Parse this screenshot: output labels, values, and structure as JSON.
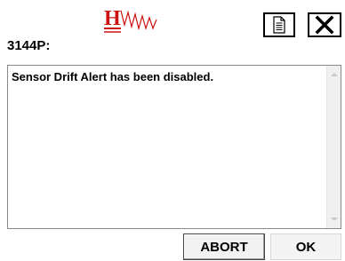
{
  "header": {
    "logo_icon": "hw-logo-icon",
    "logo_text": "H",
    "logo_color": "#cc1111",
    "doc_icon": "document-icon",
    "close_icon": "close-icon",
    "close_glyph": "✕",
    "doc_glyph": "🗎"
  },
  "device": {
    "label": "3144P:"
  },
  "message": {
    "text": "Sensor Drift Alert has been disabled."
  },
  "buttons": {
    "abort_label": "ABORT",
    "ok_label": "OK"
  }
}
